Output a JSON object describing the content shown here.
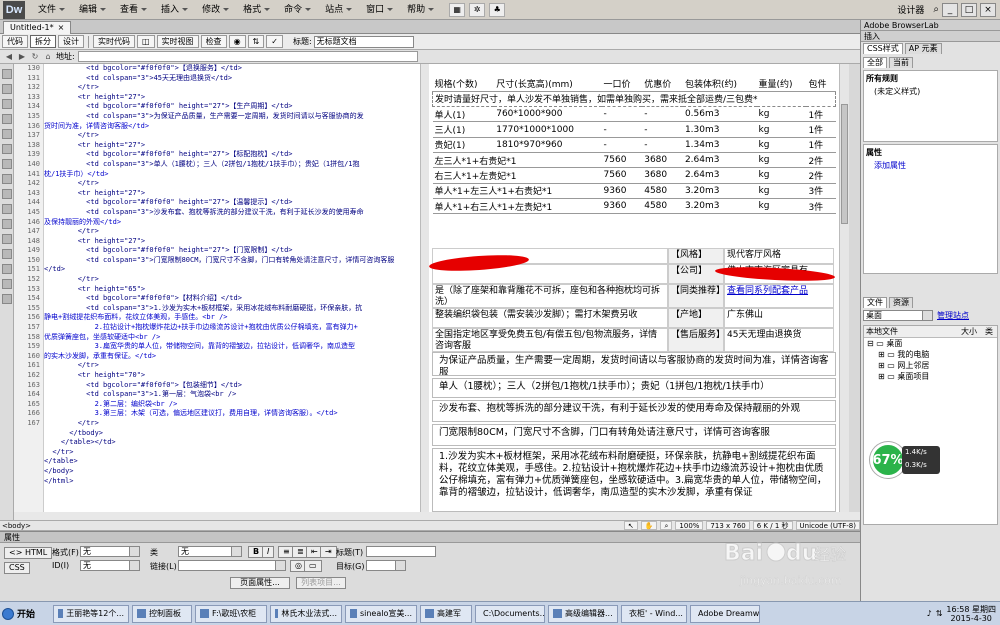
{
  "app": {
    "logo": "Dw",
    "menus": [
      "文件",
      "编辑",
      "查看",
      "插入",
      "修改",
      "格式",
      "命令",
      "站点",
      "窗口",
      "帮助"
    ],
    "workspace": "设计器",
    "search_icon": "search-icon"
  },
  "document": {
    "tab_label": "Untitled-1*",
    "tab_close": "×"
  },
  "toolbar": {
    "code": "代码",
    "split": "拆分",
    "design": "设计",
    "live_code": "实时代码",
    "live_view": "实时视图",
    "inspect": "检查",
    "title_label": "标题:",
    "title_value": "无标题文档"
  },
  "address": {
    "label": "地址:"
  },
  "code": {
    "line_numbers": [
      "130",
      "131",
      "132",
      "133",
      "134",
      "135",
      "136",
      "137",
      "138",
      "139",
      "140",
      "141",
      "142",
      "143",
      "144",
      "145",
      "146",
      "147",
      "148",
      "149",
      "150",
      "151",
      "152",
      "153",
      "154",
      "155",
      "156",
      "157",
      "158",
      "159",
      "160",
      "161",
      "162",
      "163",
      "164",
      "165",
      "166",
      "167"
    ],
    "lines": [
      "          <td bgcolor=\"#f0f0f0\">【退换服务】</td>",
      "          <td colspan=\"3\">45天无理由退换货</td>",
      "        </tr>",
      "        <tr height=\"27\">",
      "          <td bgcolor=\"#f0f0f0\" height=\"27\">【生产周期】</td>",
      "          <td colspan=\"3\">为保证产品质量，生产需要一定周期，发货时间请以与客服协商的发",
      "货时间为准，详情咨询客服</td>",
      "        </tr>",
      "        <tr height=\"27\">",
      "          <td bgcolor=\"#f0f0f0\" height=\"27\">【标配抱枕】</td>",
      "          <td colspan=\"3\">单人（1腰枕）；三人（2拼包/1抱枕/1扶手巾）；贵妃（1拼包/1抱",
      "枕/1扶手巾）</td>",
      "        </tr>",
      "        <tr height=\"27\">",
      "          <td bgcolor=\"#f0f0f0\" height=\"27\">【温馨提示】</td>",
      "          <td colspan=\"3\">沙发布套、抱枕等拆洗的部分建议干洗，有利于延长沙发的使用寿命",
      "及保持靓丽的外观</td>",
      "        </tr>",
      "        <tr height=\"27\">",
      "          <td bgcolor=\"#f0f0f0\" height=\"27\">【门宽限制】</td>",
      "          <td colspan=\"3\">门宽限制80CM，门宽尺寸不含脚，门口有转角处请注意尺寸，详情可咨询客服",
      "</td>",
      "        </tr>",
      "        <tr height=\"65\">",
      "          <td bgcolor=\"#f0f0f0\">【材料介绍】</td>",
      "          <td colspan=\"3\">1.沙发为实木+板材框架，采用冰花绒布料耐磨硬挺，环保亲肤，抗",
      "静电+割绒提花织布面料，花纹立体美观，手感佳。<br />",
      "            2.拉钻设计+抱枕爆炸花边+扶手巾边缘流苏设计+抱枕由优质公仔棉填充，富有弹力+",
      "优质弹簧座包，坐感软硬适中<br />",
      "            3.扁宽华贵的单人位，带储物空间，靠背的褶皱边，拉钻设计，低调奢华，南瓜造型",
      "的实木沙发脚，承重有保证。</td>",
      "        </tr>",
      "        <tr height=\"70\">",
      "          <td bgcolor=\"#f0f0f0\">【包装细节】</td>",
      "          <td colspan=\"3\">1.第一层：气泡袋<br />",
      "            2.第二层：编织袋<br />",
      "            3.第三层：木架（可选，偏远地区建议打，费用自理，详情咨询客服）。</td>",
      "        </tr>",
      "      </tbody>",
      "    </table></td>",
      "  </tr>",
      "</table>",
      "</body>",
      "</html>"
    ]
  },
  "design_table": {
    "header": [
      "规格(个数)",
      "尺寸(长宽高)(mm)",
      "一口价",
      "优惠价",
      "包装体积(约)",
      "重量(约)",
      "包件"
    ],
    "notice": "发时请量好尺寸，单人沙发不单独销售，如需单独购买，需来抵全部运费/三包费*",
    "rows": [
      [
        "单人(1)",
        "760*1000*900",
        "-",
        "-",
        "0.56m3",
        "kg",
        "1件"
      ],
      [
        "三人(1)",
        "1770*1000*1000",
        "-",
        "-",
        "1.30m3",
        "kg",
        "1件"
      ],
      [
        "贵妃(1)",
        "1810*970*960",
        "-",
        "-",
        "1.34m3",
        "kg",
        "1件"
      ],
      [
        "左三人*1+右贵妃*1",
        "7560",
        "3680",
        "2.64m3",
        "kg",
        "2件"
      ],
      [
        "右三人*1+左贵妃*1",
        "7560",
        "3680",
        "2.64m3",
        "kg",
        "2件"
      ],
      [
        "单人*1+左三人*1+右贵妃*1",
        "9360",
        "4580",
        "3.20m3",
        "kg",
        "3件"
      ],
      [
        "单人*1+右三人*1+左贵妃*1",
        "9360",
        "4580",
        "3.20m3",
        "kg",
        "3件"
      ]
    ]
  },
  "product": {
    "style_label": "【风格】",
    "style_value": "现代客厅风格",
    "company_label": "【公司】",
    "company_value": "佛山市南海区家具有",
    "removable_note": "是（除了座架和靠背雕花不可拆，座包和各种抱枕均可拆洗）",
    "series_label": "【同类推荐】",
    "series_link": "查看同系列配套产品",
    "packaging_note": "整装编织袋包装（需安装沙发脚）；需打木架费另收",
    "origin_label": "【产地】",
    "origin_value": "广东佛山",
    "delivery_note": "全国指定地区享受免费五包/有偿五包/包物流服务，详情咨询客服",
    "aftersale_label": "【售后服务】",
    "aftersale_value": "45天无理由退换货",
    "cycle": "为保证产品质量，生产需要一定周期，发货时间请以与客服协商的发货时间为准，详情咨询客服",
    "pillows": "单人（1腰枕）；三人（2拼包/1抱枕/1扶手巾）；贵妃（1拼包/1抱枕/1扶手巾）",
    "tips": "沙发布套、抱枕等拆洗的部分建议干洗，有利于延长沙发的使用寿命及保持靓丽的外观",
    "door": "门宽限制80CM，门宽尺寸不含脚，门口有转角处请注意尺寸，详情可咨询客服",
    "materials": "1.沙发为实木+板材框架，采用冰花绒布料耐磨硬挺，环保亲肤，抗静电+割绒提花织布面料，花纹立体美观，手感佳。2.拉钻设计+抱枕爆炸花边+扶手巾边缘流苏设计+抱枕由优质公仔棉填充，富有弹力+优质弹簧座包，坐感软硬适中。3.扁宽华贵的单人位，带储物空间，靠背的褶皱边，拉钻设计，低调奢华，南瓜造型的实木沙发脚，承重有保证"
  },
  "status": {
    "tag": "<body>",
    "zoom": "100%",
    "size": "713 x 760",
    "weight": "6 K / 1 秒",
    "encoding": "Unicode (UTF-8)"
  },
  "properties": {
    "title": "属性",
    "html_btn": "<> HTML",
    "css_btn": "CSS",
    "format_label": "格式(F)",
    "format_value": "无",
    "class_label": "类",
    "class_value": "无",
    "id_label": "ID(I)",
    "id_value": "无",
    "link_label": "链接(L)",
    "title_attr_label": "标题(T)",
    "target_label": "目标(G)",
    "page_props": "页面属性...",
    "list_items": "列表项目..."
  },
  "right_panel": {
    "browserlab": "Adobe BrowserLab",
    "insert": "插入",
    "css_tab": "CSS样式",
    "ap_tab": "AP 元素",
    "all_tab": "全部",
    "current_tab": "当前",
    "all_rules": "所有规则",
    "undefined_style": "(未定义样式)",
    "properties": "属性",
    "add_property": "添加属性",
    "files_tab": "文件",
    "assets_tab": "资源",
    "site_select": "桌面",
    "manage_sites": "管理站点",
    "local_files": "本地文件",
    "size_col": "大小",
    "type_col": "类",
    "tree": [
      "桌面",
      "我的电脑",
      "网上邻居",
      "桌面项目"
    ]
  },
  "gauge": {
    "percent": "67%",
    "up": "1.4K/s",
    "down": "0.3K/s"
  },
  "taskbar": {
    "start": "开始",
    "items": [
      "王丽艳等12个...",
      "控制面板",
      "F:\\歌班\\农柜",
      "林氏木业法式...",
      "sinealo宣美...",
      "高建军",
      "C:\\Documents...",
      "高级编辑器...",
      "衣柜' - Wind...",
      "Adobe Dreamw..."
    ],
    "time": "16:58 星期四",
    "date": "2015-4-30"
  },
  "watermark": {
    "brand": "Bai",
    "brand2": "du",
    "label": "经验",
    "url": "jingyan.baidu.com"
  }
}
